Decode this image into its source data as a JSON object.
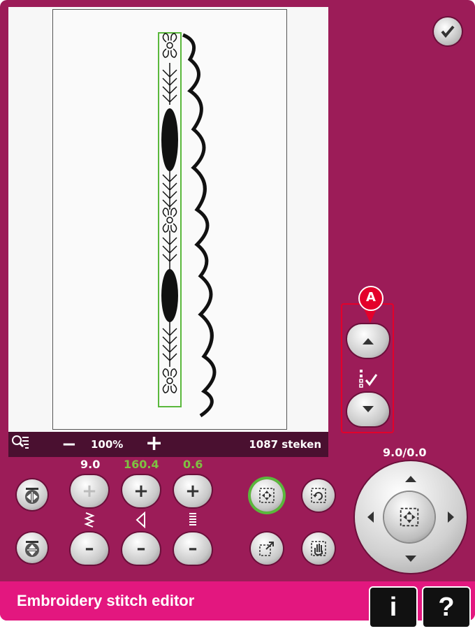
{
  "toolbar": {
    "zoom_minus": "−",
    "zoom_level": "100%",
    "zoom_plus": "+",
    "stitch_count": "1087 steken"
  },
  "callout": {
    "label": "A"
  },
  "values": {
    "width": "9.0",
    "length": "160.4",
    "density": "0.6",
    "position": "9.0/0.0"
  },
  "value_colors": {
    "width": "#ffffff",
    "length": "#7ec242",
    "density": "#7ec242"
  },
  "title": "Embroidery stitch editor",
  "buttons": {
    "info": "i",
    "help": "?"
  },
  "colors": {
    "frame": "#9c1c58",
    "title_bar": "#e3177f",
    "selection": "#5ab83c",
    "callout": "#e4002b"
  },
  "icons": [
    "zoom-options-icon",
    "confirm-check-icon",
    "scroll-up-icon",
    "scroll-down-icon",
    "stitch-position-icon",
    "mirror-sideways-icon",
    "mirror-endwise-icon",
    "width-icon",
    "length-icon",
    "density-icon",
    "move-to-center-icon",
    "rotate-icon",
    "scale-icon",
    "pan-icon",
    "arrow-up-icon",
    "arrow-down-icon",
    "arrow-left-icon",
    "arrow-right-icon",
    "info-icon",
    "help-icon"
  ]
}
